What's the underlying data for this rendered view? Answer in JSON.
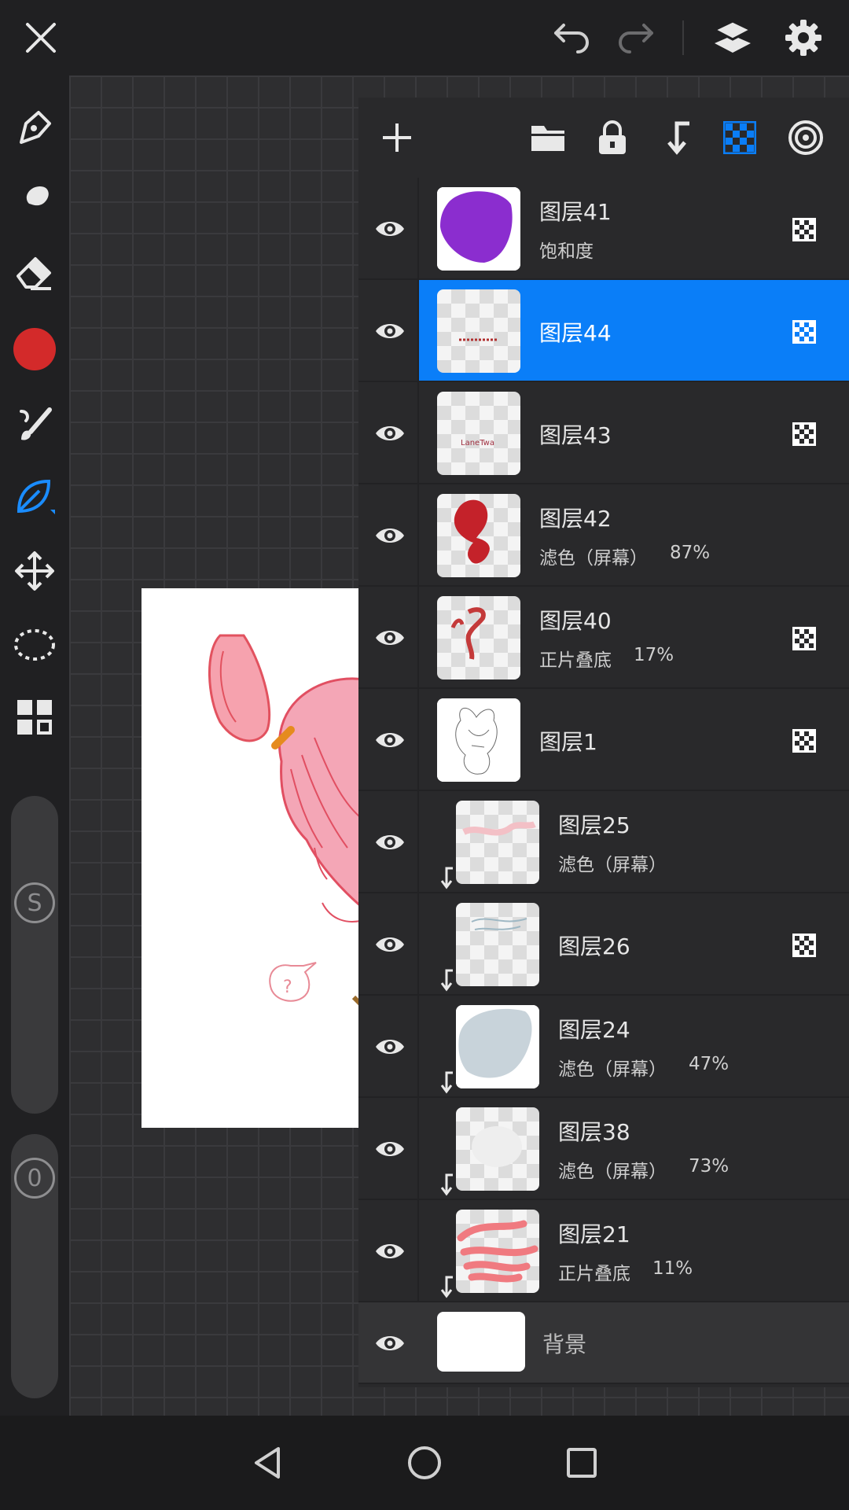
{
  "topbar": {
    "close_icon": "close-icon",
    "undo_icon": "undo-icon",
    "redo_icon": "redo-icon",
    "layers_icon": "layers-icon",
    "settings_icon": "gear-icon"
  },
  "tools": {
    "items": [
      "pen-tool-icon",
      "smudge-tool-icon",
      "eraser-tool-icon",
      "color-swatch",
      "brush-tool-icon",
      "leaf-tool-icon",
      "move-tool-icon",
      "lasso-tool-icon",
      "grid-tool-icon"
    ],
    "active_color": "#d32a2a",
    "size_label": "S",
    "opacity_label": "0"
  },
  "layer_header": {
    "add_icon": "plus-icon",
    "folder_icon": "folder-icon",
    "lock_icon": "lock-icon",
    "clip_icon": "clip-down-icon",
    "alpha_icon": "checker-icon",
    "mode_icon": "target-icon",
    "accent": "#0a7ef8"
  },
  "layers": [
    {
      "name": "图层41",
      "mode": "饱和度",
      "opacity": "",
      "selected": false,
      "clipped": false,
      "alpha_lock": true
    },
    {
      "name": "图层44",
      "mode": "",
      "opacity": "",
      "selected": true,
      "clipped": false,
      "alpha_lock": true
    },
    {
      "name": "图层43",
      "mode": "",
      "opacity": "",
      "selected": false,
      "clipped": false,
      "alpha_lock": true
    },
    {
      "name": "图层42",
      "mode": "滤色（屏幕）",
      "opacity": "87%",
      "selected": false,
      "clipped": false,
      "alpha_lock": false
    },
    {
      "name": "图层40",
      "mode": "正片叠底",
      "opacity": "17%",
      "selected": false,
      "clipped": false,
      "alpha_lock": true
    },
    {
      "name": "图层1",
      "mode": "",
      "opacity": "",
      "selected": false,
      "clipped": false,
      "alpha_lock": true
    },
    {
      "name": "图层25",
      "mode": "滤色（屏幕）",
      "opacity": "",
      "selected": false,
      "clipped": true,
      "alpha_lock": false
    },
    {
      "name": "图层26",
      "mode": "",
      "opacity": "",
      "selected": false,
      "clipped": true,
      "alpha_lock": true
    },
    {
      "name": "图层24",
      "mode": "滤色（屏幕）",
      "opacity": "47%",
      "selected": false,
      "clipped": true,
      "alpha_lock": false
    },
    {
      "name": "图层38",
      "mode": "滤色（屏幕）",
      "opacity": "73%",
      "selected": false,
      "clipped": true,
      "alpha_lock": false
    },
    {
      "name": "图层21",
      "mode": "正片叠底",
      "opacity": "11%",
      "selected": false,
      "clipped": true,
      "alpha_lock": false
    }
  ],
  "background_layer": {
    "name": "背景"
  },
  "thumb_text": {
    "layer43": "LaneTwa"
  },
  "navbar": {
    "back_icon": "back-triangle-icon",
    "home_icon": "home-circle-icon",
    "recents_icon": "recents-square-icon"
  }
}
